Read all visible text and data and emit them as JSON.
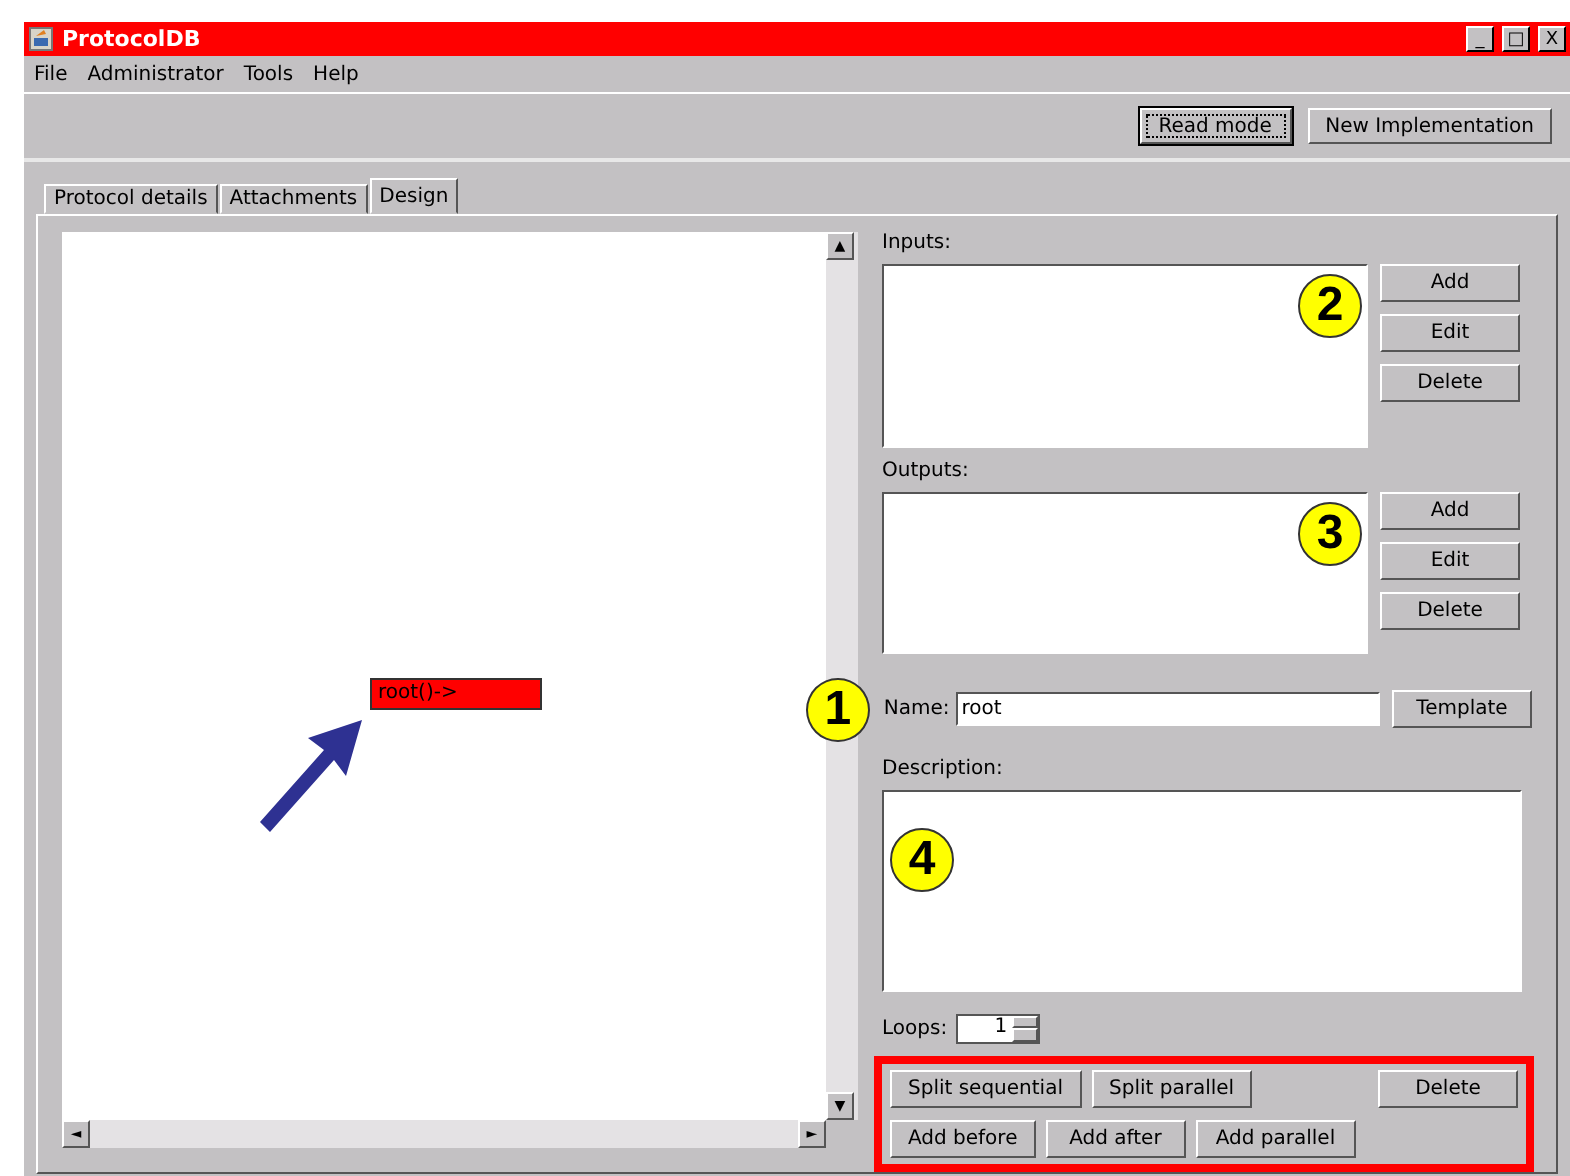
{
  "window": {
    "title": "ProtocolDB",
    "controls": [
      "_",
      "□",
      "X"
    ]
  },
  "menu": [
    "File",
    "Administrator",
    "Tools",
    "Help"
  ],
  "toolbar": [
    {
      "label": "Read mode",
      "focused": true
    },
    {
      "label": "New Implementation",
      "focused": false
    }
  ],
  "tabs": [
    {
      "label": "Protocol details",
      "selected": false
    },
    {
      "label": "Attachments",
      "selected": false
    },
    {
      "label": "Design",
      "selected": true
    }
  ],
  "canvas": {
    "node": "root()->",
    "scroll_up": "▲",
    "scroll_down": "▼",
    "scroll_left": "◄",
    "scroll_right": "►"
  },
  "inputs": {
    "label": "Inputs:",
    "callout": "2",
    "buttons": [
      "Add",
      "Edit",
      "Delete"
    ]
  },
  "outputs": {
    "label": "Outputs:",
    "callout": "3",
    "buttons": [
      "Add",
      "Edit",
      "Delete"
    ]
  },
  "name": {
    "label": "Name:",
    "value": "root",
    "callout": "1",
    "button": "Template"
  },
  "description": {
    "label": "Description:",
    "callout": "4"
  },
  "loops": {
    "label": "Loops:",
    "value": "1"
  },
  "actions": {
    "row_1": [
      "Split sequential",
      "Split parallel"
    ],
    "delete": "Delete",
    "row_2": [
      "Add before",
      "Add after",
      "Add parallel"
    ]
  }
}
